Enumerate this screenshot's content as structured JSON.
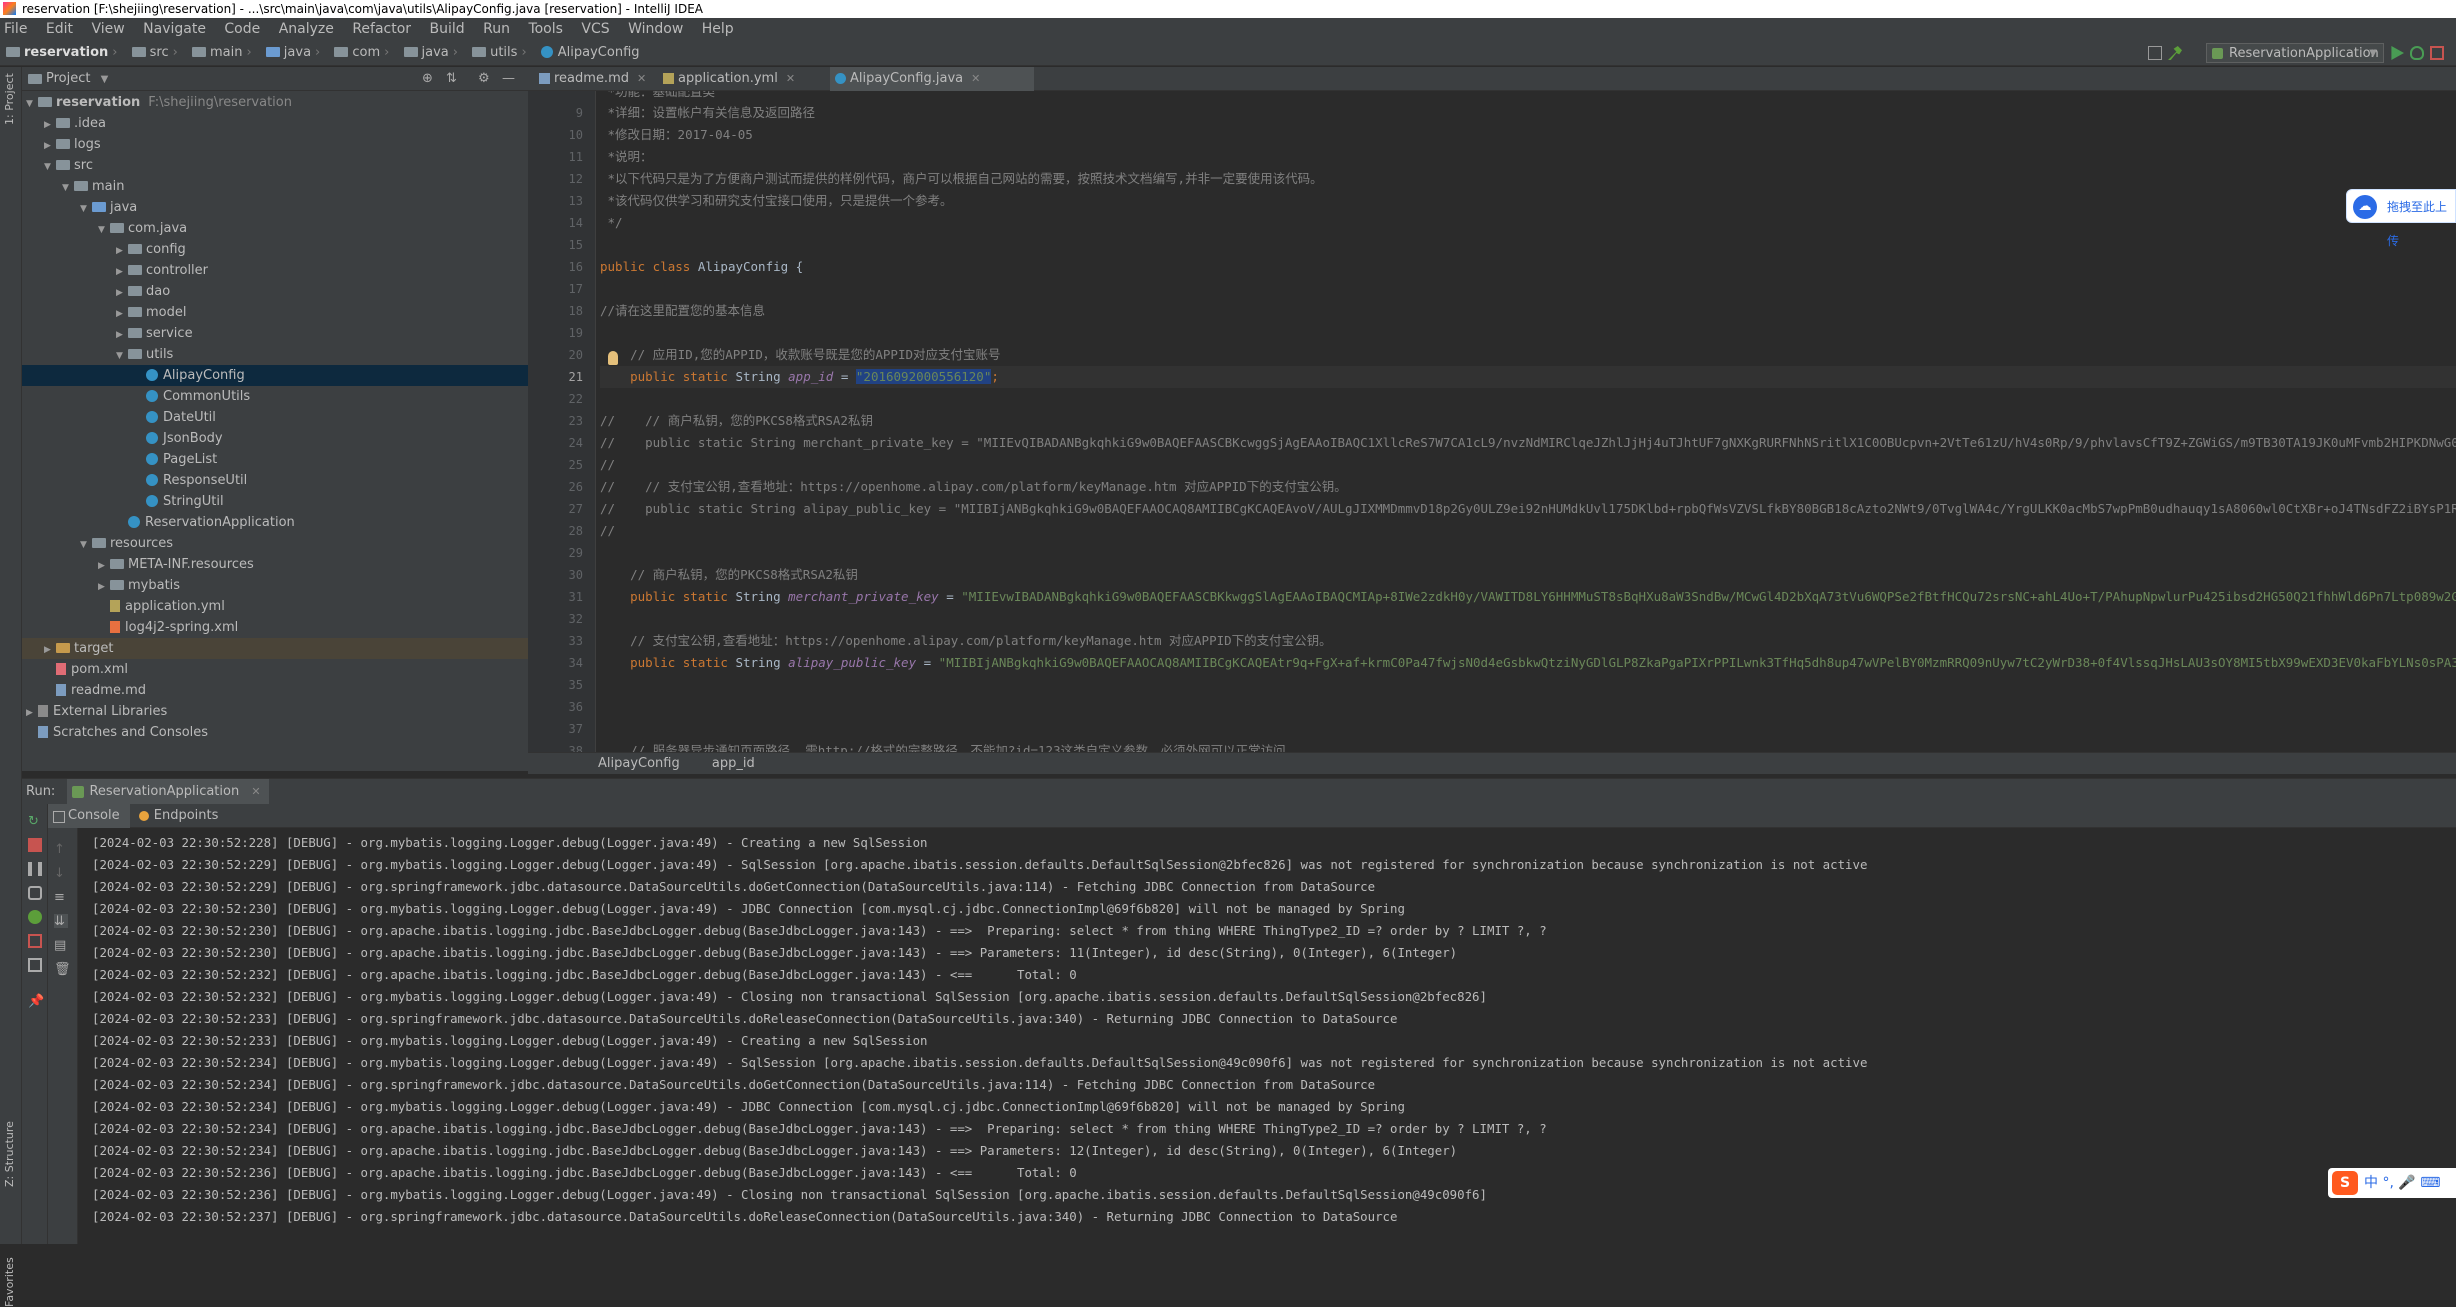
{
  "window": {
    "title": "reservation [F:\\shejiing\\reservation] - ...\\src\\main\\java\\com\\java\\utils\\AlipayConfig.java [reservation] - IntelliJ IDEA"
  },
  "menu": [
    "File",
    "Edit",
    "View",
    "Navigate",
    "Code",
    "Analyze",
    "Refactor",
    "Build",
    "Run",
    "Tools",
    "VCS",
    "Window",
    "Help"
  ],
  "nav": {
    "crumbs": [
      "reservation",
      "src",
      "main",
      "java",
      "com",
      "java",
      "utils",
      "AlipayConfig"
    ],
    "run_config": "ReservationApplication"
  },
  "sidebar": {
    "left_tabs": [
      "1: Project",
      "Z: Structure",
      "Favorites"
    ]
  },
  "project": {
    "header": "Project",
    "tree": [
      {
        "label": "reservation",
        "extra": "F:\\shejiing\\reservation",
        "depth": 0,
        "arrow": "down",
        "icon": "folder-grey"
      },
      {
        "label": ".idea",
        "depth": 1,
        "arrow": "right",
        "icon": "folder-grey"
      },
      {
        "label": "logs",
        "depth": 1,
        "arrow": "right",
        "icon": "folder-grey"
      },
      {
        "label": "src",
        "depth": 1,
        "arrow": "down",
        "icon": "folder-grey"
      },
      {
        "label": "main",
        "depth": 2,
        "arrow": "down",
        "icon": "folder-grey"
      },
      {
        "label": "java",
        "depth": 3,
        "arrow": "down",
        "icon": "folder-blue"
      },
      {
        "label": "com.java",
        "depth": 4,
        "arrow": "down",
        "icon": "folder-grey"
      },
      {
        "label": "config",
        "depth": 5,
        "arrow": "right",
        "icon": "folder-grey"
      },
      {
        "label": "controller",
        "depth": 5,
        "arrow": "right",
        "icon": "folder-grey"
      },
      {
        "label": "dao",
        "depth": 5,
        "arrow": "right",
        "icon": "folder-grey"
      },
      {
        "label": "model",
        "depth": 5,
        "arrow": "right",
        "icon": "folder-grey"
      },
      {
        "label": "service",
        "depth": 5,
        "arrow": "right",
        "icon": "folder-grey"
      },
      {
        "label": "utils",
        "depth": 5,
        "arrow": "down",
        "icon": "folder-grey"
      },
      {
        "label": "AlipayConfig",
        "depth": 6,
        "arrow": "",
        "icon": "class",
        "selected": true
      },
      {
        "label": "CommonUtils",
        "depth": 6,
        "arrow": "",
        "icon": "class"
      },
      {
        "label": "DateUtil",
        "depth": 6,
        "arrow": "",
        "icon": "class"
      },
      {
        "label": "JsonBody",
        "depth": 6,
        "arrow": "",
        "icon": "class"
      },
      {
        "label": "PageList",
        "depth": 6,
        "arrow": "",
        "icon": "class"
      },
      {
        "label": "ResponseUtil",
        "depth": 6,
        "arrow": "",
        "icon": "class"
      },
      {
        "label": "StringUtil",
        "depth": 6,
        "arrow": "",
        "icon": "class"
      },
      {
        "label": "ReservationApplication",
        "depth": 5,
        "arrow": "",
        "icon": "class"
      },
      {
        "label": "resources",
        "depth": 3,
        "arrow": "down",
        "icon": "folder-grey"
      },
      {
        "label": "META-INF.resources",
        "depth": 4,
        "arrow": "right",
        "icon": "folder-grey"
      },
      {
        "label": "mybatis",
        "depth": 4,
        "arrow": "right",
        "icon": "folder-grey"
      },
      {
        "label": "application.yml",
        "depth": 4,
        "arrow": "",
        "icon": "yml"
      },
      {
        "label": "log4j2-spring.xml",
        "depth": 4,
        "arrow": "",
        "icon": "xml"
      },
      {
        "label": "target",
        "depth": 1,
        "arrow": "right",
        "icon": "folder-orange",
        "highlight": true
      },
      {
        "label": "pom.xml",
        "depth": 1,
        "arrow": "",
        "icon": "pom"
      },
      {
        "label": "readme.md",
        "depth": 1,
        "arrow": "",
        "icon": "md"
      },
      {
        "label": "External Libraries",
        "depth": 0,
        "arrow": "right",
        "icon": "lib"
      },
      {
        "label": "Scratches and Consoles",
        "depth": 0,
        "arrow": "",
        "icon": "scratch"
      }
    ]
  },
  "editor": {
    "tabs": [
      {
        "label": "readme.md",
        "icon": "md"
      },
      {
        "label": "application.yml",
        "icon": "yml"
      },
      {
        "label": "AlipayConfig.java",
        "icon": "class",
        "active": true
      }
    ],
    "first_line_fragment": "*功能：基础配置类",
    "lines": [
      {
        "n": "9",
        "parts": [
          {
            "t": " *详细：设置帐户有关信息及返回路径",
            "c": "cmt"
          }
        ]
      },
      {
        "n": "10",
        "parts": [
          {
            "t": " *修改日期：2017-04-05",
            "c": "cmt"
          }
        ]
      },
      {
        "n": "11",
        "parts": [
          {
            "t": " *说明：",
            "c": "cmt"
          }
        ]
      },
      {
        "n": "12",
        "parts": [
          {
            "t": " *以下代码只是为了方便商户测试而提供的样例代码，商户可以根据自己网站的需要，按照技术文档编写,并非一定要使用该代码。",
            "c": "cmt"
          }
        ]
      },
      {
        "n": "13",
        "parts": [
          {
            "t": " *该代码仅供学习和研究支付宝接口使用，只是提供一个参考。",
            "c": "cmt"
          }
        ]
      },
      {
        "n": "14",
        "parts": [
          {
            "t": " */",
            "c": "cmt"
          }
        ]
      },
      {
        "n": "15",
        "parts": []
      },
      {
        "n": "16",
        "parts": [
          {
            "t": "public class ",
            "c": "kw"
          },
          {
            "t": "AlipayConfig {",
            "c": ""
          }
        ]
      },
      {
        "n": "17",
        "parts": []
      },
      {
        "n": "18",
        "parts": [
          {
            "t": "//请在这里配置您的基本信息",
            "c": "cmt"
          }
        ]
      },
      {
        "n": "19",
        "parts": []
      },
      {
        "n": "20",
        "parts": [
          {
            "t": "    // 应用ID,您的APPID，收款账号既是您的APPID对应支付宝账号",
            "c": "cmt"
          }
        ]
      },
      {
        "n": "21",
        "parts": [
          {
            "t": "    public static ",
            "c": "kw"
          },
          {
            "t": "String ",
            "c": ""
          },
          {
            "t": "app_id",
            "c": "fld"
          },
          {
            "t": " = ",
            "c": ""
          },
          {
            "t": "\"2016092000556120\"",
            "c": "str sel"
          },
          {
            "t": ";",
            "c": "kw"
          }
        ],
        "current": true
      },
      {
        "n": "22",
        "parts": []
      },
      {
        "n": "23",
        "parts": [
          {
            "t": "//    // 商户私钥，您的PKCS8格式RSA2私钥",
            "c": "cmt"
          }
        ]
      },
      {
        "n": "24",
        "parts": [
          {
            "t": "//    public static String merchant_private_key = \"MIIEvQIBADANBgkqhkiG9w0BAQEFAASCBKcwggSjAgEAAoIBAQC1XllcReS7W7CA1cL9/nvzNdMIRClqeJZhlJjHj4uTJhtUF7gNXKgRURFNhNSritlX1C0OBUcpvn+2VtTe61zU/hV4s0Rp/9/phvlavsCfT9Z+ZGWiGS/m9TB30TA19JK0uMFvmb2HIPKDNwG0aADpgSQgoN2V+0nfuN",
            "c": "cmt"
          }
        ]
      },
      {
        "n": "25",
        "parts": [
          {
            "t": "//",
            "c": "cmt"
          }
        ]
      },
      {
        "n": "26",
        "parts": [
          {
            "t": "//    // 支付宝公钥,查看地址：https://openhome.alipay.com/platform/keyManage.htm 对应APPID下的支付宝公钥。",
            "c": "cmt"
          }
        ]
      },
      {
        "n": "27",
        "parts": [
          {
            "t": "//    public static String alipay_public_key = \"MIIBIjANBgkqhkiG9w0BAQEFAAOCAQ8AMIIBCgKCAQEAvoV/AULgJIXMMDmmvD18p2Gy0ULZ9ei92nHUMdkUvl175DKlbd+rpbQfWsVZVSLfkBY80BGB18cAzto2NWt9/0TvglWA4c/YrgULKK0acMbS7wpPmB0udhauqy1sA8060wl0CtXBr+oJ4TNsdFZ2iBYsP1RXyokIZdsPhNp+L2dt",
            "c": "cmt"
          }
        ]
      },
      {
        "n": "28",
        "parts": [
          {
            "t": "//",
            "c": "cmt"
          }
        ]
      },
      {
        "n": "29",
        "parts": []
      },
      {
        "n": "30",
        "parts": [
          {
            "t": "    // 商户私钥，您的PKCS8格式RSA2私钥",
            "c": "cmt"
          }
        ]
      },
      {
        "n": "31",
        "parts": [
          {
            "t": "    public static ",
            "c": "kw"
          },
          {
            "t": "String ",
            "c": ""
          },
          {
            "t": "merchant_private_key",
            "c": "fld"
          },
          {
            "t": " = ",
            "c": ""
          },
          {
            "t": "\"MIIEvwIBADANBgkqhkiG9w0BAQEFAASCBKkwggSlAgEAAoIBAQCMIAp+8IWe2zdkH0y/VAWITD8LY6HHMMuST8sBqHXu8aW3SndBw/MCwGl4D2bXqA73tVu6WQPSe2fBtfHCQu72srsNC+ahL4Uo+T/PAhupNpwlurPu425ibsd2HG50Q21fhhWld6Pn7Ltp089w2Gvt4kTHVcIRdBYI3N\"",
            "c": "str"
          }
        ]
      },
      {
        "n": "32",
        "parts": []
      },
      {
        "n": "33",
        "parts": [
          {
            "t": "    // 支付宝公钥,查看地址：https://openhome.alipay.com/platform/keyManage.htm 对应APPID下的支付宝公钥。",
            "c": "cmt"
          }
        ]
      },
      {
        "n": "34",
        "parts": [
          {
            "t": "    public static ",
            "c": "kw"
          },
          {
            "t": "String ",
            "c": ""
          },
          {
            "t": "alipay_public_key",
            "c": "fld"
          },
          {
            "t": " = ",
            "c": ""
          },
          {
            "t": "\"MIIBIjANBgkqhkiG9w0BAQEFAAOCAQ8AMIIBCgKCAQEAtr9q+FgX+af+krmC0Pa47fwjsN0d4eGsbkwQtziNyGDlGLP8ZkaPgaPIXrPPILwnk3TfHq5dh8up47wVPelBY0MzmRRQ09nUyw7tC2yWrD38+0f4VlssqJHsLAU3sOY8MI5tbX99wEXD3EV0kaFbYLNs0sPA3HcNikJRGH4BQk3Fo\"",
            "c": "str"
          }
        ]
      },
      {
        "n": "35",
        "parts": []
      },
      {
        "n": "36",
        "parts": []
      },
      {
        "n": "37",
        "parts": []
      },
      {
        "n": "38",
        "parts": [
          {
            "t": "    // 服务器异步通知页面路径  需http://格式的完整路径，不能加?id=123这类自定义参数，必须外网可以正常访问",
            "c": "cmt"
          }
        ]
      }
    ],
    "breadcrumbs": [
      "AlipayConfig",
      "app_id"
    ]
  },
  "run": {
    "label": "Run:",
    "tab": "ReservationApplication",
    "subtabs": [
      "Console",
      "Endpoints"
    ],
    "log": [
      "[2024-02-03 22:30:52:228] [DEBUG] - org.mybatis.logging.Logger.debug(Logger.java:49) - Creating a new SqlSession",
      "[2024-02-03 22:30:52:229] [DEBUG] - org.mybatis.logging.Logger.debug(Logger.java:49) - SqlSession [org.apache.ibatis.session.defaults.DefaultSqlSession@2bfec826] was not registered for synchronization because synchronization is not active",
      "[2024-02-03 22:30:52:229] [DEBUG] - org.springframework.jdbc.datasource.DataSourceUtils.doGetConnection(DataSourceUtils.java:114) - Fetching JDBC Connection from DataSource",
      "[2024-02-03 22:30:52:230] [DEBUG] - org.mybatis.logging.Logger.debug(Logger.java:49) - JDBC Connection [com.mysql.cj.jdbc.ConnectionImpl@69f6b820] will not be managed by Spring",
      "[2024-02-03 22:30:52:230] [DEBUG] - org.apache.ibatis.logging.jdbc.BaseJdbcLogger.debug(BaseJdbcLogger.java:143) - ==>  Preparing: select * from thing WHERE ThingType2_ID =? order by ? LIMIT ?, ?",
      "[2024-02-03 22:30:52:230] [DEBUG] - org.apache.ibatis.logging.jdbc.BaseJdbcLogger.debug(BaseJdbcLogger.java:143) - ==> Parameters: 11(Integer), id desc(String), 0(Integer), 6(Integer)",
      "[2024-02-03 22:30:52:232] [DEBUG] - org.apache.ibatis.logging.jdbc.BaseJdbcLogger.debug(BaseJdbcLogger.java:143) - <==      Total: 0",
      "[2024-02-03 22:30:52:232] [DEBUG] - org.mybatis.logging.Logger.debug(Logger.java:49) - Closing non transactional SqlSession [org.apache.ibatis.session.defaults.DefaultSqlSession@2bfec826]",
      "[2024-02-03 22:30:52:233] [DEBUG] - org.springframework.jdbc.datasource.DataSourceUtils.doReleaseConnection(DataSourceUtils.java:340) - Returning JDBC Connection to DataSource",
      "[2024-02-03 22:30:52:233] [DEBUG] - org.mybatis.logging.Logger.debug(Logger.java:49) - Creating a new SqlSession",
      "[2024-02-03 22:30:52:234] [DEBUG] - org.mybatis.logging.Logger.debug(Logger.java:49) - SqlSession [org.apache.ibatis.session.defaults.DefaultSqlSession@49c090f6] was not registered for synchronization because synchronization is not active",
      "[2024-02-03 22:30:52:234] [DEBUG] - org.springframework.jdbc.datasource.DataSourceUtils.doGetConnection(DataSourceUtils.java:114) - Fetching JDBC Connection from DataSource",
      "[2024-02-03 22:30:52:234] [DEBUG] - org.mybatis.logging.Logger.debug(Logger.java:49) - JDBC Connection [com.mysql.cj.jdbc.ConnectionImpl@69f6b820] will not be managed by Spring",
      "[2024-02-03 22:30:52:234] [DEBUG] - org.apache.ibatis.logging.jdbc.BaseJdbcLogger.debug(BaseJdbcLogger.java:143) - ==>  Preparing: select * from thing WHERE ThingType2_ID =? order by ? LIMIT ?, ?",
      "[2024-02-03 22:30:52:234] [DEBUG] - org.apache.ibatis.logging.jdbc.BaseJdbcLogger.debug(BaseJdbcLogger.java:143) - ==> Parameters: 12(Integer), id desc(String), 0(Integer), 6(Integer)",
      "[2024-02-03 22:30:52:236] [DEBUG] - org.apache.ibatis.logging.jdbc.BaseJdbcLogger.debug(BaseJdbcLogger.java:143) - <==      Total: 0",
      "[2024-02-03 22:30:52:236] [DEBUG] - org.mybatis.logging.Logger.debug(Logger.java:49) - Closing non transactional SqlSession [org.apache.ibatis.session.defaults.DefaultSqlSession@49c090f6]",
      "[2024-02-03 22:30:52:237] [DEBUG] - org.springframework.jdbc.datasource.DataSourceUtils.doReleaseConnection(DataSourceUtils.java:340) - Returning JDBC Connection to DataSource"
    ]
  },
  "overlays": {
    "baidu_widget": "拖拽至此上传",
    "ime_logo": "S",
    "ime_text": "中 °, 🎤 ⌨"
  },
  "colors": {
    "accent": "#4a88c7",
    "selection": "#0d293e",
    "keyword": "#cc7832",
    "string": "#6a8759",
    "comment": "#808080",
    "field": "#9876aa"
  }
}
